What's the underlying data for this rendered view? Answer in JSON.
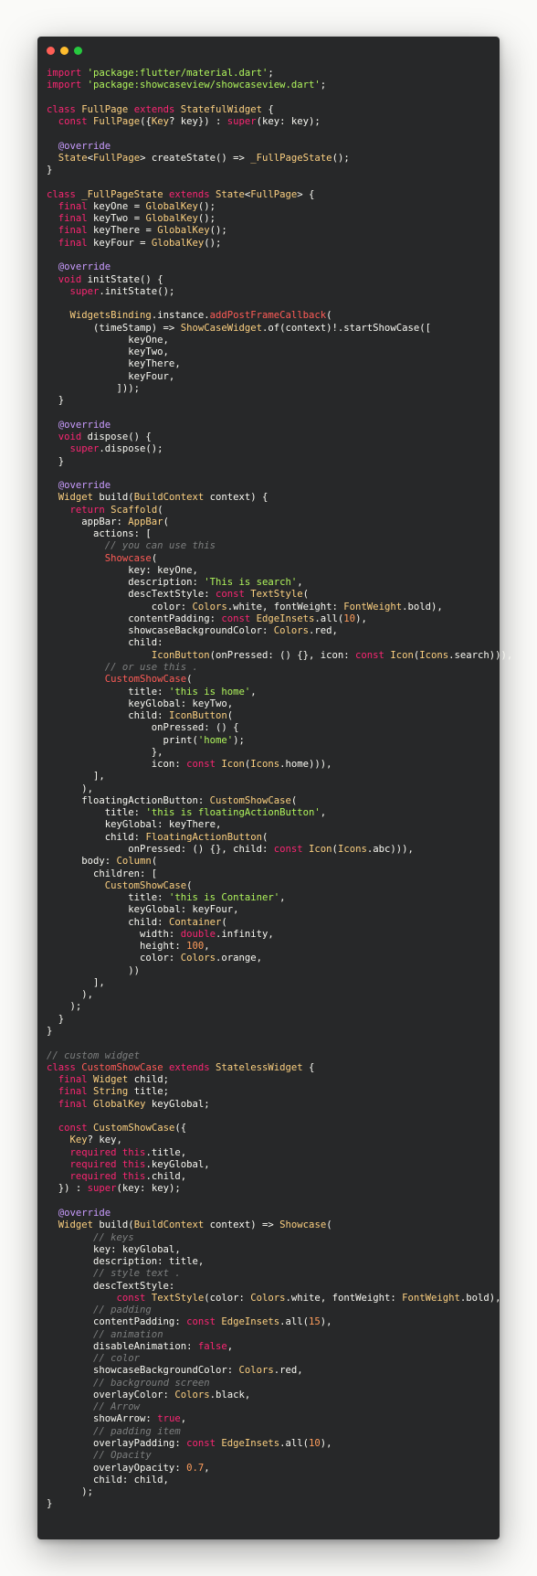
{
  "window": {
    "dots": [
      {
        "name": "close",
        "color": "#ff5f56"
      },
      {
        "name": "minimize",
        "color": "#ffbd2e"
      },
      {
        "name": "maximize",
        "color": "#27c93f"
      }
    ]
  },
  "colors": {
    "background": "#272829",
    "keyword": "#f92672",
    "type": "#fcd080",
    "string": "#aff35c",
    "annotation": "#c99cff",
    "comment": "#7d7f7f"
  },
  "code_lines": [
    [
      [
        "kw",
        "import "
      ],
      [
        "str",
        "'package:flutter/material.dart'"
      ],
      [
        "plain",
        ";"
      ]
    ],
    [
      [
        "kw",
        "import "
      ],
      [
        "str",
        "'package:showcaseview/showcaseview.dart'"
      ],
      [
        "plain",
        ";"
      ]
    ],
    [],
    [
      [
        "kw",
        "class "
      ],
      [
        "type",
        "FullPage "
      ],
      [
        "kw",
        "extends "
      ],
      [
        "type",
        "StatefulWidget "
      ],
      [
        "plain",
        "{"
      ]
    ],
    [
      [
        "plain",
        "  "
      ],
      [
        "kw",
        "const "
      ],
      [
        "type",
        "FullPage"
      ],
      [
        "plain",
        "({"
      ],
      [
        "type",
        "Key"
      ],
      [
        "plain",
        "? key}) : "
      ],
      [
        "kw",
        "super"
      ],
      [
        "plain",
        "(key: key);"
      ]
    ],
    [],
    [
      [
        "plain",
        "  "
      ],
      [
        "ann",
        "@override"
      ]
    ],
    [
      [
        "plain",
        "  "
      ],
      [
        "type",
        "State"
      ],
      [
        "plain",
        "<"
      ],
      [
        "type",
        "FullPage"
      ],
      [
        "plain",
        "> createState() => "
      ],
      [
        "type",
        "_FullPageState"
      ],
      [
        "plain",
        "();"
      ]
    ],
    [
      [
        "plain",
        "}"
      ]
    ],
    [],
    [
      [
        "kw",
        "class "
      ],
      [
        "type",
        "_FullPageState "
      ],
      [
        "kw",
        "extends "
      ],
      [
        "type",
        "State"
      ],
      [
        "plain",
        "<"
      ],
      [
        "type",
        "FullPage"
      ],
      [
        "plain",
        "> {"
      ]
    ],
    [
      [
        "plain",
        "  "
      ],
      [
        "kw",
        "final "
      ],
      [
        "plain",
        "keyOne = "
      ],
      [
        "type",
        "GlobalKey"
      ],
      [
        "plain",
        "();"
      ]
    ],
    [
      [
        "plain",
        "  "
      ],
      [
        "kw",
        "final "
      ],
      [
        "plain",
        "keyTwo = "
      ],
      [
        "type",
        "GlobalKey"
      ],
      [
        "plain",
        "();"
      ]
    ],
    [
      [
        "plain",
        "  "
      ],
      [
        "kw",
        "final "
      ],
      [
        "plain",
        "keyThere = "
      ],
      [
        "type",
        "GlobalKey"
      ],
      [
        "plain",
        "();"
      ]
    ],
    [
      [
        "plain",
        "  "
      ],
      [
        "kw",
        "final "
      ],
      [
        "plain",
        "keyFour = "
      ],
      [
        "type",
        "GlobalKey"
      ],
      [
        "plain",
        "();"
      ]
    ],
    [],
    [
      [
        "plain",
        "  "
      ],
      [
        "ann",
        "@override"
      ]
    ],
    [
      [
        "plain",
        "  "
      ],
      [
        "kw",
        "void "
      ],
      [
        "plain",
        "initState() {"
      ]
    ],
    [
      [
        "plain",
        "    "
      ],
      [
        "kw",
        "super"
      ],
      [
        "plain",
        ".initState();"
      ]
    ],
    [],
    [
      [
        "plain",
        "    "
      ],
      [
        "type",
        "WidgetsBinding"
      ],
      [
        "plain",
        ".instance."
      ],
      [
        "red",
        "addPostFrameCallback"
      ],
      [
        "plain",
        "("
      ]
    ],
    [
      [
        "plain",
        "        (timeStamp) => "
      ],
      [
        "type",
        "ShowCaseWidget"
      ],
      [
        "plain",
        ".of(context)!.startShowCase(["
      ]
    ],
    [
      [
        "plain",
        "              keyOne,"
      ]
    ],
    [
      [
        "plain",
        "              keyTwo,"
      ]
    ],
    [
      [
        "plain",
        "              keyThere,"
      ]
    ],
    [
      [
        "plain",
        "              keyFour,"
      ]
    ],
    [
      [
        "plain",
        "            ]));"
      ]
    ],
    [
      [
        "plain",
        "  }"
      ]
    ],
    [],
    [
      [
        "plain",
        "  "
      ],
      [
        "ann",
        "@override"
      ]
    ],
    [
      [
        "plain",
        "  "
      ],
      [
        "kw",
        "void "
      ],
      [
        "plain",
        "dispose() {"
      ]
    ],
    [
      [
        "plain",
        "    "
      ],
      [
        "kw",
        "super"
      ],
      [
        "plain",
        ".dispose();"
      ]
    ],
    [
      [
        "plain",
        "  }"
      ]
    ],
    [],
    [
      [
        "plain",
        "  "
      ],
      [
        "ann",
        "@override"
      ]
    ],
    [
      [
        "plain",
        "  "
      ],
      [
        "type",
        "Widget "
      ],
      [
        "plain",
        "build("
      ],
      [
        "type",
        "BuildContext "
      ],
      [
        "plain",
        "context) {"
      ]
    ],
    [
      [
        "plain",
        "    "
      ],
      [
        "kw",
        "return "
      ],
      [
        "type",
        "Scaffold"
      ],
      [
        "plain",
        "("
      ]
    ],
    [
      [
        "plain",
        "      appBar: "
      ],
      [
        "type",
        "AppBar"
      ],
      [
        "plain",
        "("
      ]
    ],
    [
      [
        "plain",
        "        actions: ["
      ]
    ],
    [
      [
        "plain",
        "          "
      ],
      [
        "com",
        "// you can use this"
      ]
    ],
    [
      [
        "plain",
        "          "
      ],
      [
        "red",
        "Showcase"
      ],
      [
        "plain",
        "("
      ]
    ],
    [
      [
        "plain",
        "              key: keyOne,"
      ]
    ],
    [
      [
        "plain",
        "              description: "
      ],
      [
        "str",
        "'This is search'"
      ],
      [
        "plain",
        ","
      ]
    ],
    [
      [
        "plain",
        "              descTextStyle: "
      ],
      [
        "kw",
        "const "
      ],
      [
        "type",
        "TextStyle"
      ],
      [
        "plain",
        "("
      ]
    ],
    [
      [
        "plain",
        "                  color: "
      ],
      [
        "type",
        "Colors"
      ],
      [
        "plain",
        ".white, fontWeight: "
      ],
      [
        "type",
        "FontWeight"
      ],
      [
        "plain",
        ".bold),"
      ]
    ],
    [
      [
        "plain",
        "              contentPadding: "
      ],
      [
        "kw",
        "const "
      ],
      [
        "type",
        "EdgeInsets"
      ],
      [
        "plain",
        ".all("
      ],
      [
        "num",
        "10"
      ],
      [
        "plain",
        "),"
      ]
    ],
    [
      [
        "plain",
        "              showcaseBackgroundColor: "
      ],
      [
        "type",
        "Colors"
      ],
      [
        "plain",
        ".red,"
      ]
    ],
    [
      [
        "plain",
        "              child:"
      ]
    ],
    [
      [
        "plain",
        "                  "
      ],
      [
        "type",
        "IconButton"
      ],
      [
        "plain",
        "(onPressed: () {}, icon: "
      ],
      [
        "kw",
        "const "
      ],
      [
        "type",
        "Icon"
      ],
      [
        "plain",
        "("
      ],
      [
        "type",
        "Icons"
      ],
      [
        "plain",
        ".search))),"
      ]
    ],
    [
      [
        "plain",
        "          "
      ],
      [
        "com",
        "// or use this ."
      ]
    ],
    [
      [
        "plain",
        "          "
      ],
      [
        "red",
        "CustomShowCase"
      ],
      [
        "plain",
        "("
      ]
    ],
    [
      [
        "plain",
        "              title: "
      ],
      [
        "str",
        "'this is home'"
      ],
      [
        "plain",
        ","
      ]
    ],
    [
      [
        "plain",
        "              keyGlobal: keyTwo,"
      ]
    ],
    [
      [
        "plain",
        "              child: "
      ],
      [
        "type",
        "IconButton"
      ],
      [
        "plain",
        "("
      ]
    ],
    [
      [
        "plain",
        "                  onPressed: () {"
      ]
    ],
    [
      [
        "plain",
        "                    print("
      ],
      [
        "str",
        "'home'"
      ],
      [
        "plain",
        ");"
      ]
    ],
    [
      [
        "plain",
        "                  },"
      ]
    ],
    [
      [
        "plain",
        "                  icon: "
      ],
      [
        "kw",
        "const "
      ],
      [
        "type",
        "Icon"
      ],
      [
        "plain",
        "("
      ],
      [
        "type",
        "Icons"
      ],
      [
        "plain",
        ".home))),"
      ]
    ],
    [
      [
        "plain",
        "        ],"
      ]
    ],
    [
      [
        "plain",
        "      ),"
      ]
    ],
    [
      [
        "plain",
        "      floatingActionButton: "
      ],
      [
        "type",
        "CustomShowCase"
      ],
      [
        "plain",
        "("
      ]
    ],
    [
      [
        "plain",
        "          title: "
      ],
      [
        "str",
        "'this is floatingActionButton'"
      ],
      [
        "plain",
        ","
      ]
    ],
    [
      [
        "plain",
        "          keyGlobal: keyThere,"
      ]
    ],
    [
      [
        "plain",
        "          child: "
      ],
      [
        "type",
        "FloatingActionButton"
      ],
      [
        "plain",
        "("
      ]
    ],
    [
      [
        "plain",
        "              onPressed: () {}, child: "
      ],
      [
        "kw",
        "const "
      ],
      [
        "type",
        "Icon"
      ],
      [
        "plain",
        "("
      ],
      [
        "type",
        "Icons"
      ],
      [
        "plain",
        ".abc))),"
      ]
    ],
    [
      [
        "plain",
        "      body: "
      ],
      [
        "type",
        "Column"
      ],
      [
        "plain",
        "("
      ]
    ],
    [
      [
        "plain",
        "        children: ["
      ]
    ],
    [
      [
        "plain",
        "          "
      ],
      [
        "type",
        "CustomShowCase"
      ],
      [
        "plain",
        "("
      ]
    ],
    [
      [
        "plain",
        "              title: "
      ],
      [
        "str",
        "'this is Container'"
      ],
      [
        "plain",
        ","
      ]
    ],
    [
      [
        "plain",
        "              keyGlobal: keyFour,"
      ]
    ],
    [
      [
        "plain",
        "              child: "
      ],
      [
        "type",
        "Container"
      ],
      [
        "plain",
        "("
      ]
    ],
    [
      [
        "plain",
        "                width: "
      ],
      [
        "kw",
        "double"
      ],
      [
        "plain",
        ".infinity,"
      ]
    ],
    [
      [
        "plain",
        "                height: "
      ],
      [
        "num",
        "100"
      ],
      [
        "plain",
        ","
      ]
    ],
    [
      [
        "plain",
        "                color: "
      ],
      [
        "type",
        "Colors"
      ],
      [
        "plain",
        ".orange,"
      ]
    ],
    [
      [
        "plain",
        "              ))"
      ]
    ],
    [
      [
        "plain",
        "        ],"
      ]
    ],
    [
      [
        "plain",
        "      ),"
      ]
    ],
    [
      [
        "plain",
        "    );"
      ]
    ],
    [
      [
        "plain",
        "  }"
      ]
    ],
    [
      [
        "plain",
        "}"
      ]
    ],
    [],
    [
      [
        "com",
        "// custom widget"
      ]
    ],
    [
      [
        "kw",
        "class "
      ],
      [
        "red",
        "CustomShowCase "
      ],
      [
        "kw",
        "extends "
      ],
      [
        "type",
        "StatelessWidget "
      ],
      [
        "plain",
        "{"
      ]
    ],
    [
      [
        "plain",
        "  "
      ],
      [
        "kw",
        "final "
      ],
      [
        "type",
        "Widget "
      ],
      [
        "plain",
        "child;"
      ]
    ],
    [
      [
        "plain",
        "  "
      ],
      [
        "kw",
        "final "
      ],
      [
        "type",
        "String "
      ],
      [
        "plain",
        "title;"
      ]
    ],
    [
      [
        "plain",
        "  "
      ],
      [
        "kw",
        "final "
      ],
      [
        "type",
        "GlobalKey "
      ],
      [
        "plain",
        "keyGlobal;"
      ]
    ],
    [],
    [
      [
        "plain",
        "  "
      ],
      [
        "kw",
        "const "
      ],
      [
        "type",
        "CustomShowCase"
      ],
      [
        "plain",
        "({"
      ]
    ],
    [
      [
        "plain",
        "    "
      ],
      [
        "type",
        "Key"
      ],
      [
        "plain",
        "? key,"
      ]
    ],
    [
      [
        "plain",
        "    "
      ],
      [
        "kw",
        "required this"
      ],
      [
        "plain",
        ".title,"
      ]
    ],
    [
      [
        "plain",
        "    "
      ],
      [
        "kw",
        "required this"
      ],
      [
        "plain",
        ".keyGlobal,"
      ]
    ],
    [
      [
        "plain",
        "    "
      ],
      [
        "kw",
        "required this"
      ],
      [
        "plain",
        ".child,"
      ]
    ],
    [
      [
        "plain",
        "  }) : "
      ],
      [
        "kw",
        "super"
      ],
      [
        "plain",
        "(key: key);"
      ]
    ],
    [],
    [
      [
        "plain",
        "  "
      ],
      [
        "ann",
        "@override"
      ]
    ],
    [
      [
        "plain",
        "  "
      ],
      [
        "type",
        "Widget "
      ],
      [
        "plain",
        "build("
      ],
      [
        "type",
        "BuildContext "
      ],
      [
        "plain",
        "context) => "
      ],
      [
        "type",
        "Showcase"
      ],
      [
        "plain",
        "("
      ]
    ],
    [
      [
        "plain",
        "        "
      ],
      [
        "com",
        "// keys"
      ]
    ],
    [
      [
        "plain",
        "        key: keyGlobal,"
      ]
    ],
    [
      [
        "plain",
        "        description: title,"
      ]
    ],
    [
      [
        "plain",
        "        "
      ],
      [
        "com",
        "// style text ."
      ]
    ],
    [
      [
        "plain",
        "        descTextStyle:"
      ]
    ],
    [
      [
        "plain",
        "            "
      ],
      [
        "kw",
        "const "
      ],
      [
        "type",
        "TextStyle"
      ],
      [
        "plain",
        "(color: "
      ],
      [
        "type",
        "Colors"
      ],
      [
        "plain",
        ".white, fontWeight: "
      ],
      [
        "type",
        "FontWeight"
      ],
      [
        "plain",
        ".bold),"
      ]
    ],
    [
      [
        "plain",
        "        "
      ],
      [
        "com",
        "// padding"
      ]
    ],
    [
      [
        "plain",
        "        contentPadding: "
      ],
      [
        "kw",
        "const "
      ],
      [
        "type",
        "EdgeInsets"
      ],
      [
        "plain",
        ".all("
      ],
      [
        "num",
        "15"
      ],
      [
        "plain",
        "),"
      ]
    ],
    [
      [
        "plain",
        "        "
      ],
      [
        "com",
        "// animation"
      ]
    ],
    [
      [
        "plain",
        "        disableAnimation: "
      ],
      [
        "kw",
        "false"
      ],
      [
        "plain",
        ","
      ]
    ],
    [
      [
        "plain",
        "        "
      ],
      [
        "com",
        "// color"
      ]
    ],
    [
      [
        "plain",
        "        showcaseBackgroundColor: "
      ],
      [
        "type",
        "Colors"
      ],
      [
        "plain",
        ".red,"
      ]
    ],
    [
      [
        "plain",
        "        "
      ],
      [
        "com",
        "// background screen"
      ]
    ],
    [
      [
        "plain",
        "        overlayColor: "
      ],
      [
        "type",
        "Colors"
      ],
      [
        "plain",
        ".black,"
      ]
    ],
    [
      [
        "plain",
        "        "
      ],
      [
        "com",
        "// Arrow"
      ]
    ],
    [
      [
        "plain",
        "        showArrow: "
      ],
      [
        "kw",
        "true"
      ],
      [
        "plain",
        ","
      ]
    ],
    [
      [
        "plain",
        "        "
      ],
      [
        "com",
        "// padding item"
      ]
    ],
    [
      [
        "plain",
        "        overlayPadding: "
      ],
      [
        "kw",
        "const "
      ],
      [
        "type",
        "EdgeInsets"
      ],
      [
        "plain",
        ".all("
      ],
      [
        "num",
        "10"
      ],
      [
        "plain",
        "),"
      ]
    ],
    [
      [
        "plain",
        "        "
      ],
      [
        "com",
        "// Opacity"
      ]
    ],
    [
      [
        "plain",
        "        overlayOpacity: "
      ],
      [
        "num",
        "0.7"
      ],
      [
        "plain",
        ","
      ]
    ],
    [
      [
        "plain",
        "        child: child,"
      ]
    ],
    [
      [
        "plain",
        "      );"
      ]
    ],
    [
      [
        "plain",
        "}"
      ]
    ]
  ]
}
